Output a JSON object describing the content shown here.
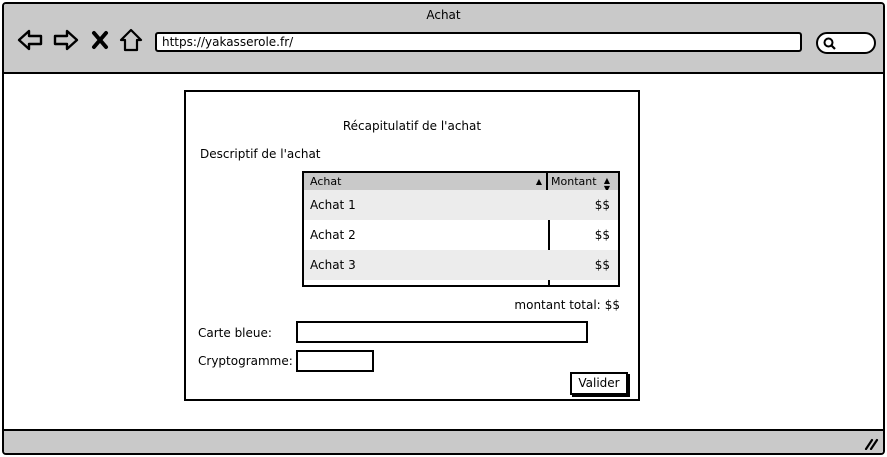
{
  "window": {
    "title": "Achat"
  },
  "toolbar": {
    "url": "https://yakasserole.fr/",
    "icons": [
      "back-icon",
      "forward-icon",
      "close-icon",
      "home-icon",
      "search-icon"
    ]
  },
  "page": {
    "heading": "Récapitulatif de l'achat",
    "subheading": "Descriptif de l'achat",
    "table": {
      "columns": [
        {
          "label": "Achat",
          "sort": "ascending"
        },
        {
          "label": "Montant",
          "sort": "both"
        }
      ],
      "rows": [
        {
          "name": "Achat 1",
          "amount": "$$"
        },
        {
          "name": "Achat 2",
          "amount": "$$"
        },
        {
          "name": "Achat 3",
          "amount": "$$"
        }
      ]
    },
    "total": {
      "label": "montant total:",
      "value": "$$"
    },
    "form": {
      "card_label": "Carte bleue:",
      "card_value": "",
      "cvv_label": "Cryptogramme:",
      "cvv_value": ""
    },
    "submit_label": "Valider"
  },
  "colors": {
    "chrome": "#c9c9c9",
    "row_alt": "#ececec",
    "border": "#000000"
  }
}
